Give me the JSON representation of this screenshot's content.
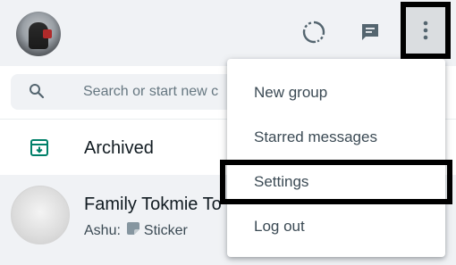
{
  "header": {
    "avatar_icon": "profile-avatar",
    "status_icon": "status-ring-icon",
    "new_chat_icon": "chat-icon",
    "menu_icon": "kebab-menu-icon"
  },
  "search": {
    "placeholder": "Search or start new c"
  },
  "archived": {
    "label": "Archived",
    "icon": "archive-icon",
    "accent": "#008069"
  },
  "chats": [
    {
      "name": "Family Tokmie To",
      "sender": "Ashu:",
      "preview": "Sticker"
    }
  ],
  "menu": {
    "items": [
      {
        "label": "New group"
      },
      {
        "label": "Starred messages"
      },
      {
        "label": "Settings"
      },
      {
        "label": "Log out"
      }
    ]
  }
}
